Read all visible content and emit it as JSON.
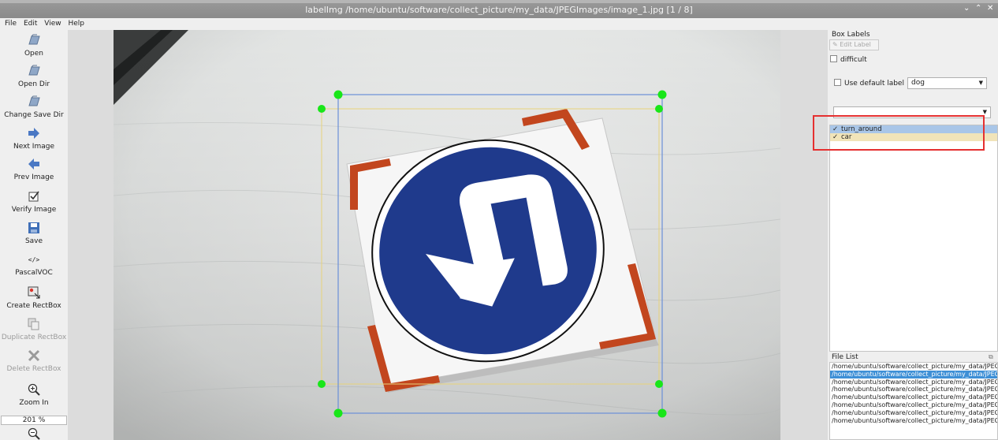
{
  "window": {
    "title": "labelImg /home/ubuntu/software/collect_picture/my_data/JPEGImages/image_1.jpg [1 / 8]",
    "controls": [
      "⌄",
      "⌃",
      "✕"
    ]
  },
  "menu": [
    "File",
    "Edit",
    "View",
    "Help"
  ],
  "toolbar": {
    "items": [
      {
        "label": "Open",
        "icon": "open-folder-icon",
        "enabled": true
      },
      {
        "label": "Open Dir",
        "icon": "open-dir-icon",
        "enabled": true
      },
      {
        "label": "Change Save Dir",
        "icon": "change-save-dir-icon",
        "enabled": true
      },
      {
        "label": "Next Image",
        "icon": "arrow-right-icon",
        "enabled": true
      },
      {
        "label": "Prev Image",
        "icon": "arrow-left-icon",
        "enabled": true
      },
      {
        "label": "Verify Image",
        "icon": "verify-check-icon",
        "enabled": true
      },
      {
        "label": "Save",
        "icon": "save-floppy-icon",
        "enabled": true
      },
      {
        "label": "PascalVOC",
        "icon": "format-code-icon",
        "enabled": true
      },
      {
        "label": "Create RectBox",
        "icon": "create-rect-icon",
        "enabled": true
      },
      {
        "label": "Duplicate RectBox",
        "icon": "duplicate-rect-icon",
        "enabled": false
      },
      {
        "label": "Delete RectBox",
        "icon": "delete-x-icon",
        "enabled": false
      },
      {
        "label": "Zoom In",
        "icon": "zoom-in-icon",
        "enabled": true
      }
    ],
    "zoom_value": "201 %"
  },
  "box_labels": {
    "title": "Box Labels",
    "edit_label_button": "Edit Label",
    "difficult": "difficult",
    "use_default_label": "Use default label",
    "default_label_value": "dog",
    "labels": [
      {
        "name": "turn_around",
        "checked": true,
        "bg": "#a9c6e8"
      },
      {
        "name": "car",
        "checked": true,
        "bg": "#f1e4b9"
      }
    ],
    "check_mark": "✓"
  },
  "file_list": {
    "title": "File List",
    "files": [
      "/home/ubuntu/software/collect_picture/my_data/JPEG",
      "/home/ubuntu/software/collect_picture/my_data/JPEG",
      "/home/ubuntu/software/collect_picture/my_data/JPEG",
      "/home/ubuntu/software/collect_picture/my_data/JPEG",
      "/home/ubuntu/software/collect_picture/my_data/JPEG",
      "/home/ubuntu/software/collect_picture/my_data/JPEG",
      "/home/ubuntu/software/collect_picture/my_data/JPEG",
      "/home/ubuntu/software/collect_picture/my_data/JPEG"
    ],
    "selected_index": 1
  },
  "colors": {
    "selection_blue": "#3d8fd6",
    "handle_green": "#19e619",
    "box_blue": "#6a8fd8",
    "box_yellow": "#e8d37a",
    "highlight_red": "#e53030",
    "sign_blue": "#1f3a8c",
    "sign_orange": "#c2461e"
  }
}
